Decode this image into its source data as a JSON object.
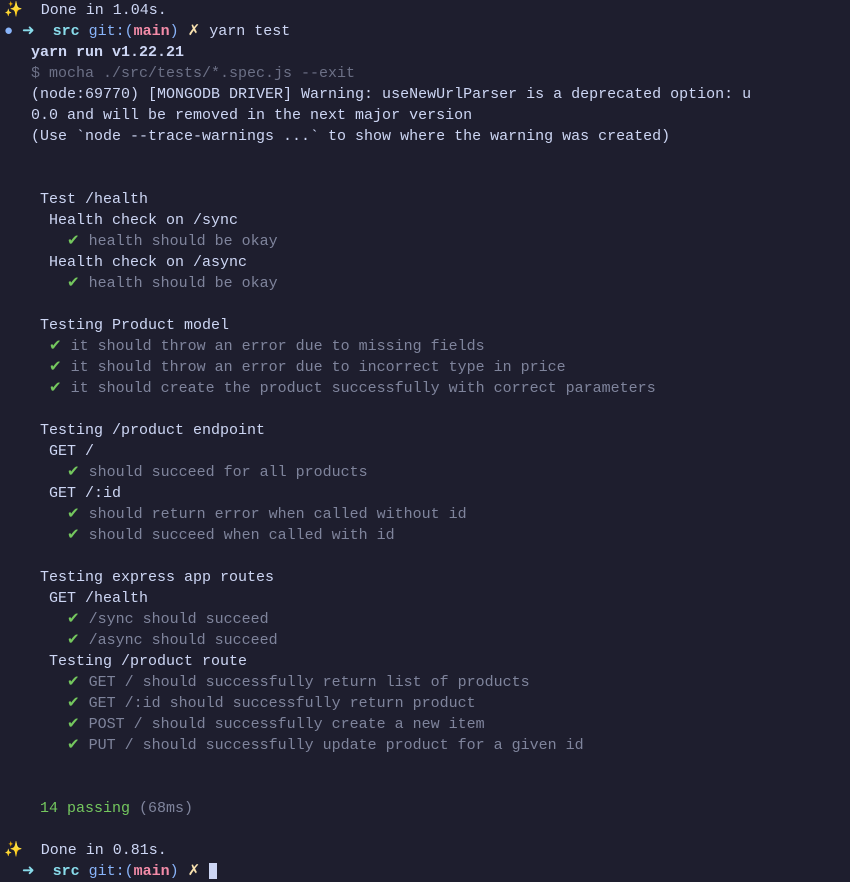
{
  "top": {
    "sparkle": "✨",
    "done1": "  Done in 1.04s.",
    "dot": "●",
    "arrow": " ➜ ",
    "src": " src",
    "git_open": " git:(",
    "branch": "main",
    "git_close": ")",
    "xmark": " ✗",
    "command": " yarn test"
  },
  "run": {
    "yarn_run": "   yarn run v1.22.21",
    "mocha": "   $ mocha ./src/tests/*.spec.js --exit",
    "warn1": "   (node:69770) [MONGODB DRIVER] Warning: useNewUrlParser is a deprecated option: u",
    "warn2": "   0.0 and will be removed in the next major version",
    "warn3": "   (Use `node --trace-warnings ...` to show where the warning was created)"
  },
  "suites": {
    "s1": {
      "title": "Test /health",
      "c1": "Health check on /sync",
      "t1": "health should be okay",
      "c2": "Health check on /async",
      "t2": "health should be okay"
    },
    "s2": {
      "title": "Testing Product model",
      "t1": "it should throw an error due to missing fields",
      "t2": "it should throw an error due to incorrect type in price",
      "t3": "it should create the product successfully with correct parameters"
    },
    "s3": {
      "title": "Testing /product endpoint",
      "c1": "GET /",
      "t1": "should succeed for all products",
      "c2": "GET /:id",
      "t2": "should return error when called without id",
      "t3": "should succeed when called with id"
    },
    "s4": {
      "title": "Testing express app routes",
      "c1": "GET /health",
      "t1": "/sync should succeed",
      "t2": "/async should succeed",
      "c2": "Testing /product route",
      "t3": "GET / should successfully return list of products",
      "t4": "GET /:id should successfully return product",
      "t5": "POST / should successfully create a new item",
      "t6": "PUT / should successfully update product for a given id"
    }
  },
  "summary": {
    "passing": "14 passing",
    "time": " (68ms)"
  },
  "bottom": {
    "sparkle": "✨",
    "done2": "  Done in 0.81s."
  },
  "checkmark": "✔"
}
